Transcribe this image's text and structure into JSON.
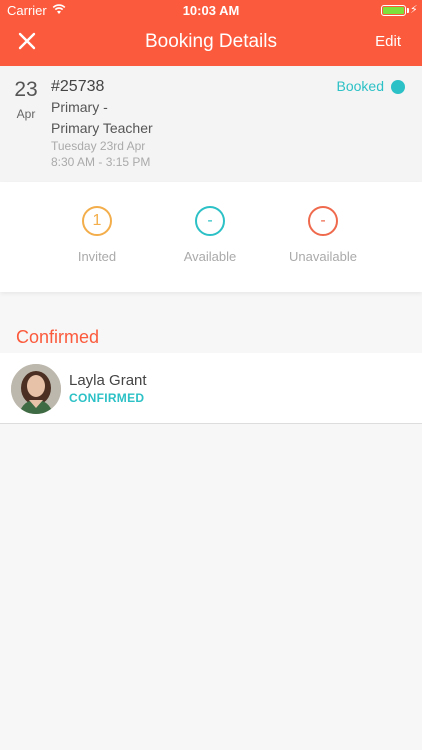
{
  "status_bar": {
    "carrier": "Carrier",
    "time": "10:03 AM",
    "battery_level": 1.0
  },
  "nav": {
    "title": "Booking Details",
    "edit_label": "Edit",
    "close_icon": "close-icon"
  },
  "booking": {
    "day": "23",
    "month": "Apr",
    "reference": "#25738",
    "line1": "Primary -",
    "line2": "Primary Teacher",
    "date": "Tuesday 23rd Apr",
    "time": "8:30 AM - 3:15 PM",
    "status": "Booked",
    "status_color": "#2cc1c6"
  },
  "stats": [
    {
      "value": "1",
      "label": "Invited",
      "color": "#f3ae4b"
    },
    {
      "value": "-",
      "label": "Available",
      "color": "#2cc1c6"
    },
    {
      "value": "-",
      "label": "Unavailable",
      "color": "#ef6a4d"
    }
  ],
  "confirmed": {
    "section_title": "Confirmed",
    "people": [
      {
        "name": "Layla Grant",
        "status": "CONFIRMED"
      }
    ]
  },
  "colors": {
    "accent": "#fb5a3c",
    "teal": "#2cc1c6"
  }
}
